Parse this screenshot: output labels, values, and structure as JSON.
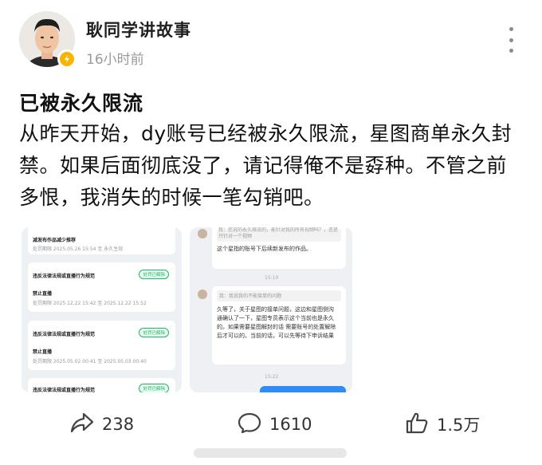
{
  "author": {
    "name": "耿同学讲故事",
    "time": "16小时前",
    "verified": true
  },
  "post": {
    "title": "已被永久限流",
    "body": "从昨天开始，dy账号已经被永久限流，星图商单永久封禁。如果后面彻底没了，请记得俺不是孬种。不管之前多恨，我消失的时候一笔勾销吧。"
  },
  "left_image": {
    "top_line1": "减发布作品减少推荐",
    "top_line2": "处罚期限 2025.05.26 15:54 至 永久生效",
    "cards": [
      {
        "title": "违反法律法规或直播行为规范",
        "badge": "处罚已解除",
        "sub": "禁止直播",
        "meta": "处罚期限 2025.12.22 15:42 至 2025.12.22 15:52"
      },
      {
        "title": "违反法律法规或直播行为规范",
        "badge": "处罚已解除",
        "sub": "禁止直播",
        "meta": "处罚期限 2025.05.02 00:41 至 2025.05.03 00:40"
      },
      {
        "title": "违反法律法规或直播行为规范",
        "badge": "处罚已解除",
        "sub": "",
        "meta": ""
      }
    ]
  },
  "right_image": {
    "q1": "我：您说的永久限流的，能针对我的所有视频吗？，还是只针对一个视频",
    "a1": "这个星指的账号下后续新发布的作品。",
    "t1": "15:10",
    "q2": "我：我说我的不能接单的问题",
    "a2": "久等了，关于星图的接单问题，这边和星图侧沟通确认了一下，星图专员表示这个当前也是永久的。如果需要星图解封的话 需要账号的处置解除后才可以的。当前的话，可以先等待下申诉结果",
    "t2": "15:22"
  },
  "actions": {
    "share": {
      "icon": "share-icon",
      "count": "238"
    },
    "comment": {
      "icon": "comment-icon",
      "count": "1610"
    },
    "like": {
      "icon": "like-icon",
      "count": "1.5万"
    }
  },
  "colors": {
    "verified_badge": "#f7b500",
    "pill_green": "#1db86a",
    "chat_blue": "#2f8cf5"
  }
}
